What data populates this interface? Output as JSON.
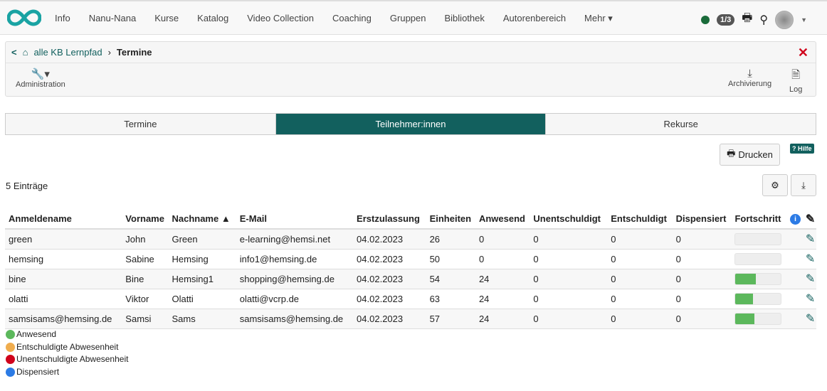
{
  "nav": {
    "items": [
      "Info",
      "Nanu-Nana",
      "Kurse",
      "Katalog",
      "Video Collection",
      "Coaching",
      "Gruppen",
      "Bibliothek",
      "Autorenbereich",
      "Mehr ▾"
    ],
    "counter": "1/3"
  },
  "breadcrumb": {
    "parent": "alle KB Lernpfad",
    "current": "Termine"
  },
  "toolbar": {
    "admin": "Administration",
    "archive": "Archivierung",
    "log": "Log"
  },
  "tabs": [
    "Termine",
    "Teilnehmer:innen",
    "Rekurse"
  ],
  "actions": {
    "print": "Drucken",
    "help": "Hilfe"
  },
  "count": "5 Einträge",
  "table": {
    "headers": [
      "Anmeldename",
      "Vorname",
      "Nachname ▲",
      "E-Mail",
      "Erstzulassung",
      "Einheiten",
      "Anwesend",
      "Unentschuldigt",
      "Entschuldigt",
      "Dispensiert",
      "Fortschritt"
    ],
    "rows": [
      [
        "green",
        "John",
        "Green",
        "e-learning@hemsi.net",
        "04.02.2023",
        "26",
        "0",
        "0",
        "0",
        "0"
      ],
      [
        "hemsing",
        "Sabine",
        "Hemsing",
        "info1@hemsing.de",
        "04.02.2023",
        "50",
        "0",
        "0",
        "0",
        "0"
      ],
      [
        "bine",
        "Bine",
        "Hemsing1",
        "shopping@hemsing.de",
        "04.02.2023",
        "54",
        "24",
        "0",
        "0",
        "0"
      ],
      [
        "olatti",
        "Viktor",
        "Olatti",
        "olatti@vcrp.de",
        "04.02.2023",
        "63",
        "24",
        "0",
        "0",
        "0"
      ],
      [
        "samsisams@hemsing.de",
        "Samsi",
        "Sams",
        "samsisams@hemsing.de",
        "04.02.2023",
        "57",
        "24",
        "0",
        "0",
        "0"
      ]
    ],
    "progress": [
      0,
      0,
      44,
      38,
      42
    ]
  },
  "legend": [
    {
      "label": "Anwesend",
      "color": "#5cb85c"
    },
    {
      "label": "Entschuldigte Abwesenheit",
      "color": "#f0ad4e"
    },
    {
      "label": "Unentschuldigte Abwesenheit",
      "color": "#d0021b"
    },
    {
      "label": "Dispensiert",
      "color": "#2c7be5"
    }
  ]
}
